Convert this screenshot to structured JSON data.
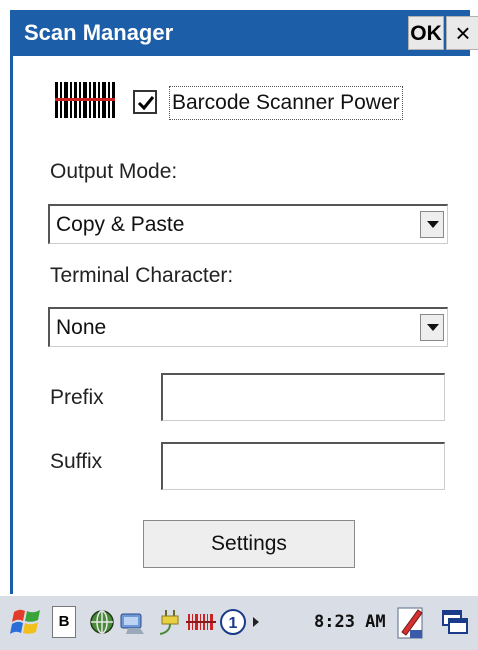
{
  "window": {
    "title": "Scan Manager",
    "ok_label": "OK",
    "close_label": "×"
  },
  "scanner": {
    "power_checked": true,
    "power_label": "Barcode Scanner Power"
  },
  "output_mode": {
    "label": "Output Mode:",
    "selected": "Copy & Paste"
  },
  "terminal_character": {
    "label": "Terminal Character:",
    "selected": "None"
  },
  "prefix": {
    "label": "Prefix",
    "value": ""
  },
  "suffix": {
    "label": "Suffix",
    "value": ""
  },
  "settings_button": {
    "label": "Settings"
  },
  "taskbar": {
    "input_indicator": "B",
    "notification_count": "1",
    "time": "8:23 AM"
  },
  "colors": {
    "titlebar": "#1c5ea8",
    "taskbar": "#d9dee6",
    "barcode_red": "#cc2222"
  },
  "icons": [
    "barcode-icon",
    "start-flag-icon",
    "network-icon",
    "connectivity-icon",
    "power-plug-icon",
    "barcode-tray-icon",
    "notification-icon",
    "arrow-right-icon",
    "pen-input-icon",
    "switch-window-icon"
  ]
}
